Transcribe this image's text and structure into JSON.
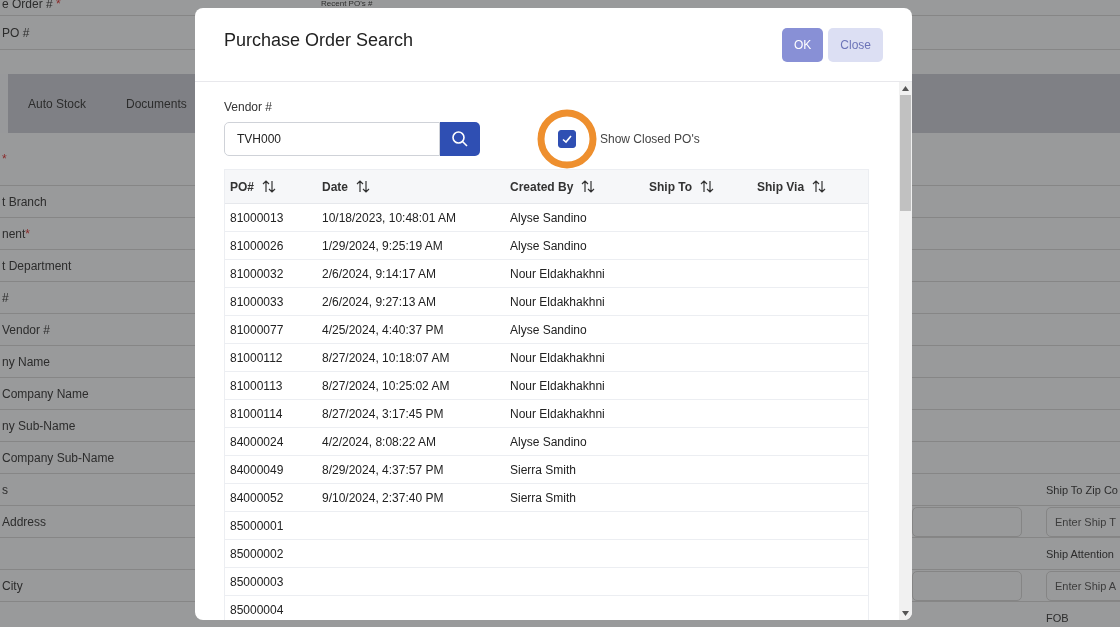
{
  "background": {
    "top_label": "e Order #",
    "top_mark": "*",
    "top_middle_label": "Recent PO's #",
    "po_label": "PO #",
    "tabs": [
      {
        "selected": true
      },
      {
        "label": "Auto Stock",
        "selected": false
      },
      {
        "label": "Documents",
        "selected": false
      }
    ],
    "rows": [
      {
        "label": "",
        "mark": "*",
        "right": []
      },
      {
        "label": "t Branch",
        "mark": "",
        "right": []
      },
      {
        "label": "nent",
        "mark": "*",
        "right": []
      },
      {
        "label": "t Department",
        "mark": "",
        "right": []
      },
      {
        "label": "#",
        "mark": "",
        "right": []
      },
      {
        "label": "Vendor #",
        "mark": "",
        "right": []
      },
      {
        "label": "ny Name",
        "mark": "",
        "right": []
      },
      {
        "label": "Company Name",
        "mark": "",
        "right": []
      },
      {
        "label": "ny Sub-Name",
        "mark": "",
        "right": []
      },
      {
        "label": "Company Sub-Name",
        "mark": "",
        "right": []
      },
      {
        "label": "s",
        "mark": "",
        "right": [
          {
            "kind": "label",
            "text": "Ship To Zip Co"
          }
        ]
      },
      {
        "label": "Address",
        "mark": "",
        "right": [
          {
            "kind": "field"
          },
          {
            "kind": "field",
            "placeholder": "Enter Ship T"
          }
        ]
      },
      {
        "label": "",
        "mark": "",
        "right": [
          {
            "kind": "label",
            "text": "Ship Attention"
          }
        ]
      },
      {
        "label": "City",
        "mark": "",
        "right": [
          {
            "kind": "field"
          },
          {
            "kind": "field",
            "placeholder": "Enter Ship A"
          }
        ]
      },
      {
        "label": "",
        "mark": "",
        "right": [
          {
            "kind": "label",
            "text": "FOB"
          }
        ]
      }
    ]
  },
  "dialog": {
    "title": "Purchase Order Search",
    "buttons": [
      {
        "label": "OK",
        "kind": "primary"
      },
      {
        "label": "Close",
        "kind": "secondary"
      }
    ],
    "vendor_label": "Vendor #",
    "vendor_value": "TVH000",
    "show_closed": {
      "label": "Show Closed PO's",
      "checked": true
    },
    "table": {
      "columns": [
        "PO#",
        "Date",
        "Created By",
        "Ship To",
        "Ship Via"
      ],
      "rows": [
        [
          "81000013",
          "10/18/2023, 10:48:01 AM",
          "Alyse Sandino"
        ],
        [
          "81000026",
          "1/29/2024, 9:25:19 AM",
          "Alyse Sandino"
        ],
        [
          "81000032",
          "2/6/2024, 9:14:17 AM",
          "Nour Eldakhakhni"
        ],
        [
          "81000033",
          "2/6/2024, 9:27:13 AM",
          "Nour Eldakhakhni"
        ],
        [
          "81000077",
          "4/25/2024, 4:40:37 PM",
          "Alyse Sandino"
        ],
        [
          "81000112",
          "8/27/2024, 10:18:07 AM",
          "Nour Eldakhakhni"
        ],
        [
          "81000113",
          "8/27/2024, 10:25:02 AM",
          "Nour Eldakhakhni"
        ],
        [
          "81000114",
          "8/27/2024, 3:17:45 PM",
          "Nour Eldakhakhni"
        ],
        [
          "84000024",
          "4/2/2024, 8:08:22 AM",
          "Alyse Sandino"
        ],
        [
          "84000049",
          "8/29/2024, 4:37:57 PM",
          "Sierra Smith"
        ],
        [
          "84000052",
          "9/10/2024, 2:37:40 PM",
          "Sierra Smith"
        ],
        [
          "85000001"
        ],
        [
          "85000002"
        ],
        [
          "85000003"
        ],
        [
          "85000004"
        ]
      ]
    }
  }
}
